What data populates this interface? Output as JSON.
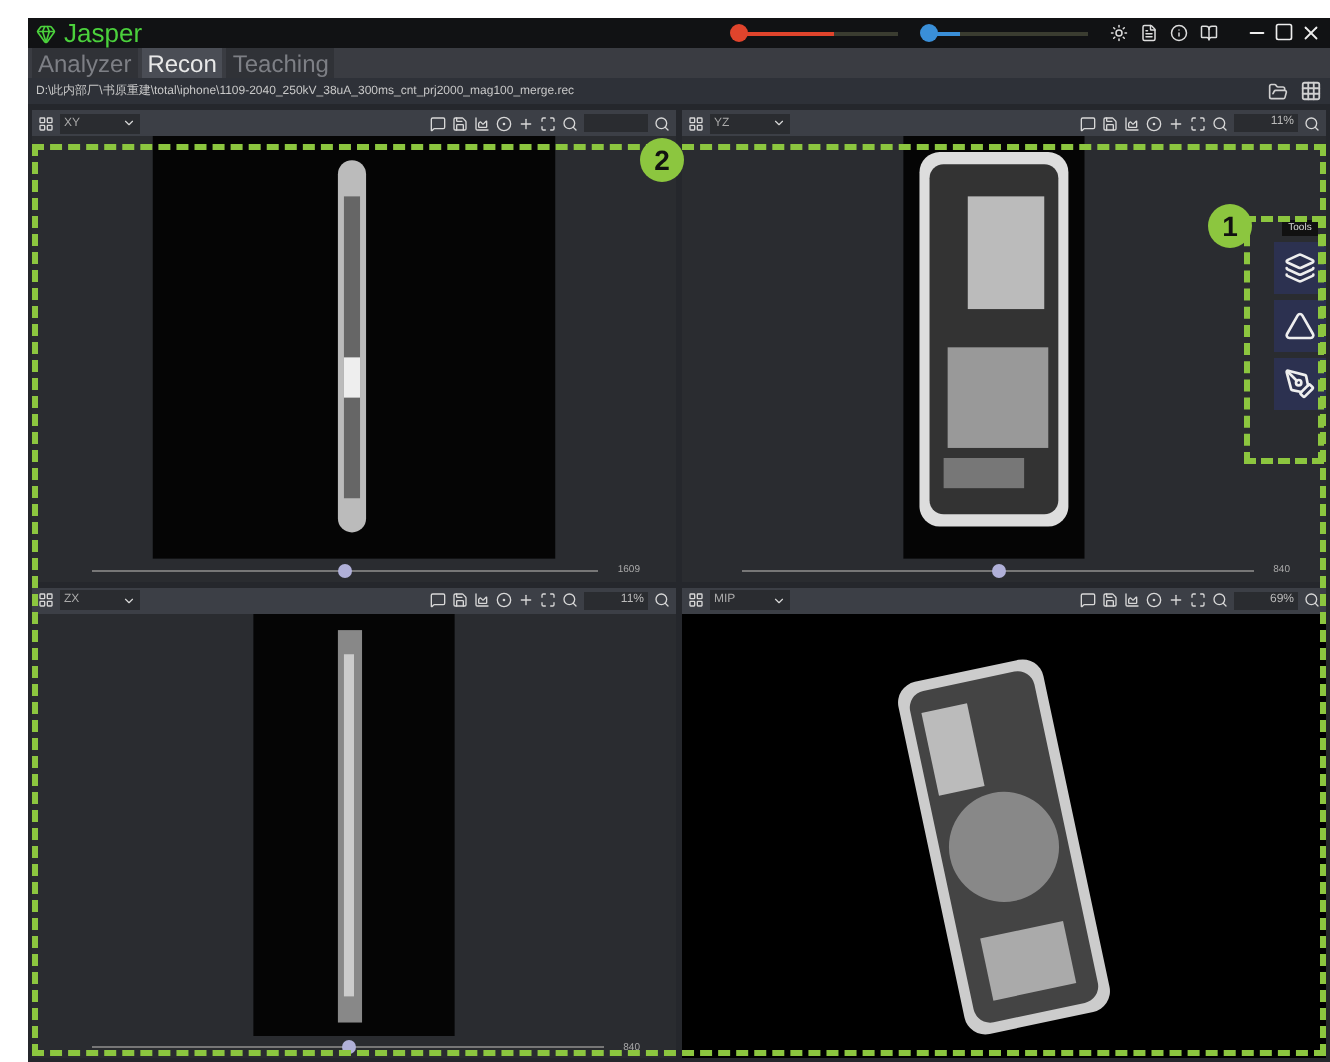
{
  "window": {
    "title": "Jasper"
  },
  "title_sliders": [
    {
      "level": 0.6,
      "color": "#e0442c"
    },
    {
      "level": 0.2,
      "color": "#3a8fd8"
    }
  ],
  "tabs": [
    {
      "label": "Analyzer",
      "selected": false
    },
    {
      "label": "Recon",
      "selected": true
    },
    {
      "label": "Teaching",
      "selected": false
    }
  ],
  "path": "D:\\此内部厂\\书原重建\\total\\iphone\\1109-2040_250kV_38uA_300ms_cnt_prj2000_mag100_merge.rec",
  "viewports": [
    {
      "view": "XY",
      "kind": "side",
      "slice": "1609",
      "level": 0.5
    },
    {
      "view": "YZ",
      "kind": "front",
      "zoom": "11%",
      "slice": "840",
      "level": 0.5
    },
    {
      "view": "ZX",
      "kind": "thin",
      "zoom": "11%",
      "slice": "840",
      "level": 0.5
    },
    {
      "view": "MIP",
      "kind": "tilted",
      "zoom": "69%"
    }
  ],
  "tools": {
    "title": "Tools",
    "items": [
      {
        "kind": "layers"
      },
      {
        "kind": "ruler"
      },
      {
        "kind": "pen"
      }
    ]
  },
  "callouts": [
    {
      "label": "1"
    },
    {
      "label": "2"
    }
  ]
}
